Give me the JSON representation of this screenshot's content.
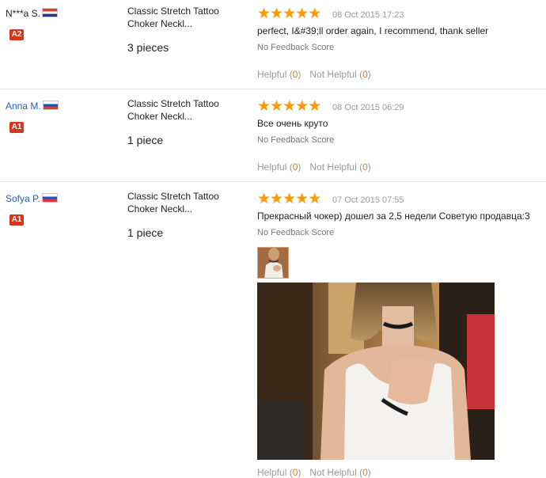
{
  "reviews": [
    {
      "buyer": "N***a S.",
      "flag": "hr",
      "badge": "A2",
      "product": "Classic Stretch Tattoo Choker Neckl...",
      "quantity": "3 pieces",
      "rating": 5,
      "date": "08 Oct 2015 17:23",
      "text": "perfect, I&#39;ll order again, I recommend, thank seller",
      "feedback": "No Feedback Score",
      "helpful_label": "Helpful",
      "helpful_count": "0",
      "not_helpful_label": "Not Helpful",
      "not_helpful_count": "0"
    },
    {
      "buyer": "Anna M.",
      "flag": "ru",
      "badge": "A1",
      "product": "Classic Stretch Tattoo Choker Neckl...",
      "quantity": "1 piece",
      "rating": 5,
      "date": "08 Oct 2015 06:29",
      "text": "Все очень круто",
      "feedback": "No Feedback Score",
      "helpful_label": "Helpful",
      "helpful_count": "0",
      "not_helpful_label": "Not Helpful",
      "not_helpful_count": "0"
    },
    {
      "buyer": "Sofya P.",
      "flag": "ru",
      "badge": "A1",
      "product": "Classic Stretch Tattoo Choker Neckl...",
      "quantity": "1 piece",
      "rating": 5,
      "date": "07 Oct 2015 07:55",
      "text": "Прекрасный чокер) дошел за 2,5 недели Советую продавца:3",
      "feedback": "No Feedback Score",
      "helpful_label": "Helpful",
      "helpful_count": "0",
      "not_helpful_label": "Not Helpful",
      "not_helpful_count": "0"
    }
  ],
  "colors": {
    "star": "#f79a0e",
    "badge": "#d7351f",
    "link": "#2a5db0",
    "count": "#e8781c"
  }
}
